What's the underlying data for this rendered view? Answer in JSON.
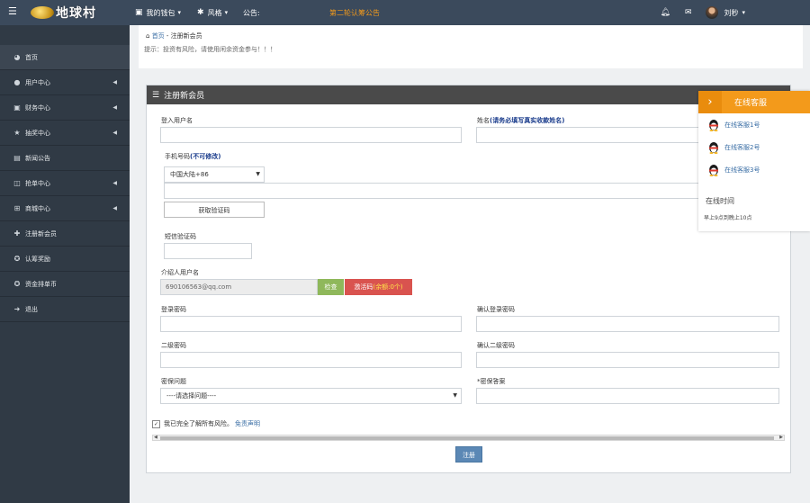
{
  "topbar": {
    "logo_text": "地球村",
    "nav": [
      {
        "label": "我的钱包",
        "icon": "briefcase-icon"
      },
      {
        "label": "风格",
        "icon": "gear-icon"
      }
    ],
    "announcement_label": "公告:",
    "announcement_text": "第二轮认筹公告",
    "user_name": "刘秒"
  },
  "sidebar": {
    "items": [
      {
        "label": "首页",
        "icon": "dashboard-icon",
        "arrow": false
      },
      {
        "label": "用户中心",
        "icon": "user-icon",
        "arrow": true
      },
      {
        "label": "财务中心",
        "icon": "briefcase-icon",
        "arrow": true
      },
      {
        "label": "抽奖中心",
        "icon": "star-icon",
        "arrow": true
      },
      {
        "label": "新闻公告",
        "icon": "news-icon",
        "arrow": false
      },
      {
        "label": "抢单中心",
        "icon": "columns-icon",
        "arrow": true
      },
      {
        "label": "商城中心",
        "icon": "cart-icon",
        "arrow": true
      },
      {
        "label": "注册新会员",
        "icon": "user-plus-icon",
        "arrow": false
      },
      {
        "label": "认筹奖励",
        "icon": "gift-icon",
        "arrow": false
      },
      {
        "label": "资金排单币",
        "icon": "coin-icon",
        "arrow": false
      },
      {
        "label": "退出",
        "icon": "logout-icon",
        "arrow": false
      }
    ]
  },
  "breadcrumb": {
    "home": "首页",
    "current": "- 注册新会员",
    "tip": "提示：投资有风险，请使用闲余资金参与！！！"
  },
  "form": {
    "title": "注册新会员",
    "username_label": "登入用户名",
    "name_label": "姓名",
    "name_note": "(请务必填写真实收款姓名)",
    "phone_label": "手机号码",
    "phone_note": "(不可修改)",
    "country_value": "中国大陆+86",
    "get_code_button": "获取验证码",
    "sms_label": "短信验证码",
    "referrer_label": "介绍人用户名",
    "referrer_value": "690106563@qq.com",
    "check_button": "检查",
    "activation_label": "激活码",
    "activation_remaining": "(余额:0个)",
    "login_pwd_label": "登录密码",
    "confirm_login_pwd_label": "确认登录密码",
    "second_pwd_label": "二级密码",
    "confirm_second_pwd_label": "确认二级密码",
    "security_q_label": "密保问题",
    "security_q_value": "----请选择问题----",
    "security_a_label": "*密保答案",
    "agree_text": "我已完全了解所有风险。",
    "disclaimer_link": "免责声明",
    "submit_button": "注册"
  },
  "customer_service": {
    "title": "在线客服",
    "agents": [
      "在线客服1号",
      "在线客服2号",
      "在线客服3号"
    ],
    "time_title": "在线时间",
    "time_text": "早上9点到晚上10点"
  },
  "colors": {
    "topbar": "#3b4a5c",
    "sidebar": "#303a45",
    "accent_orange": "#f39a1b",
    "announcement": "#f39a1b",
    "primary": "#5b88b5"
  }
}
